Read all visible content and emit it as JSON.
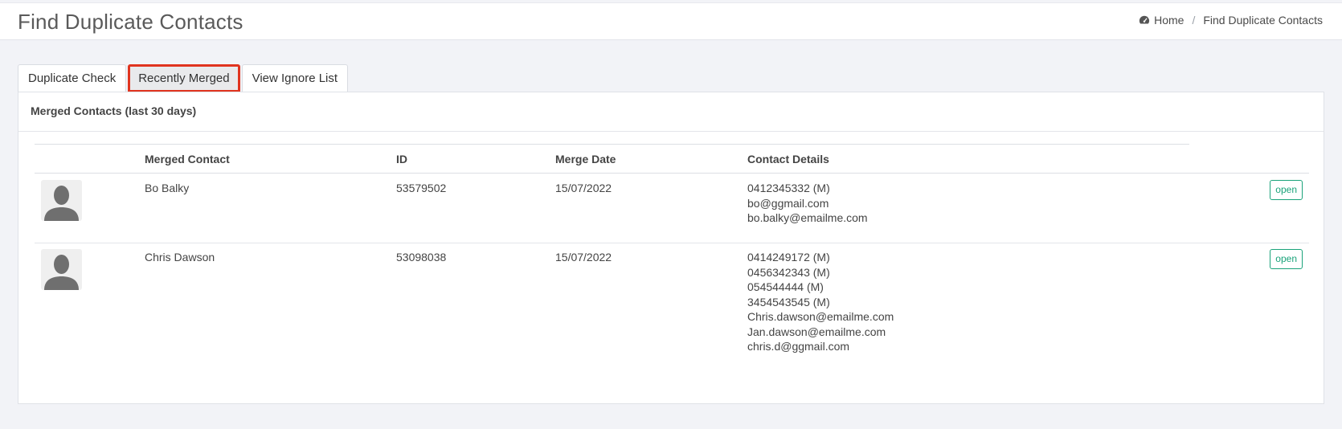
{
  "header": {
    "title": "Find Duplicate Contacts",
    "breadcrumb": {
      "home": "Home",
      "separator": "/",
      "current": "Find Duplicate Contacts"
    }
  },
  "tabs": [
    {
      "label": "Duplicate Check",
      "active": false
    },
    {
      "label": "Recently Merged",
      "active": true
    },
    {
      "label": "View Ignore List",
      "active": false
    }
  ],
  "panel": {
    "heading": "Merged Contacts (last 30 days)",
    "columns": [
      "Merged Contact",
      "ID",
      "Merge Date",
      "Contact Details"
    ],
    "rows": [
      {
        "name": "Bo Balky",
        "id": "53579502",
        "date": "15/07/2022",
        "details": [
          "0412345332 (M)",
          "bo@ggmail.com",
          "bo.balky@emailme.com"
        ],
        "action": "open"
      },
      {
        "name": "Chris Dawson",
        "id": "53098038",
        "date": "15/07/2022",
        "details": [
          "0414249172 (M)",
          "0456342343 (M)",
          "054544444 (M)",
          "3454543545 (M)",
          "Chris.dawson@emailme.com",
          "Jan.dawson@emailme.com",
          "chris.d@ggmail.com"
        ],
        "action": "open"
      }
    ]
  },
  "colors": {
    "accent": "#1aa37a",
    "highlight": "#e0341f"
  },
  "icons": {
    "home": "dashboard-icon",
    "avatar": "user-silhouette-icon"
  }
}
